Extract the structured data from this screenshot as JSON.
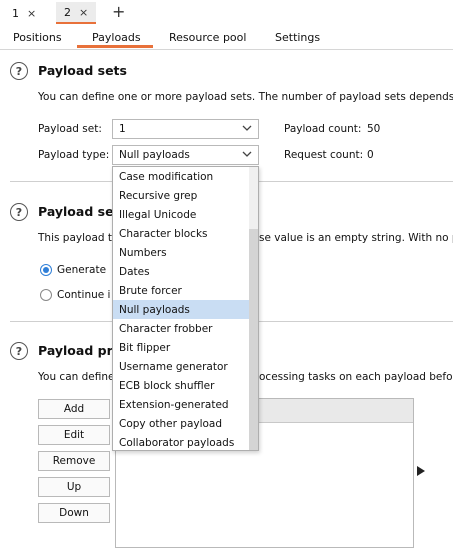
{
  "request_tabs": [
    {
      "label": "1",
      "close": "×"
    },
    {
      "label": "2",
      "close": "×"
    }
  ],
  "add_tab": "+",
  "subtabs": [
    "Positions",
    "Payloads",
    "Resource pool",
    "Settings"
  ],
  "payload_sets": {
    "title": "Payload sets",
    "description": "You can define one or more payload sets. The number of payload sets depends o",
    "set_label": "Payload set:",
    "set_value": "1",
    "type_label": "Payload type:",
    "type_value": "Null payloads",
    "count_label": "Payload count:",
    "count_value": "50",
    "request_label": "Request count:",
    "request_value": "0"
  },
  "payload_settings": {
    "title": "Payload set",
    "desc_left": "This payload ty",
    "desc_right": "se value is an empty string. With no pa",
    "radio1": "Generate",
    "radio2": "Continue i"
  },
  "payload_processing": {
    "title": "Payload pro",
    "desc_left": "You can define",
    "desc_right": "ocessing tasks on each payload before",
    "buttons": [
      "Add",
      "Edit",
      "Remove",
      "Up",
      "Down"
    ]
  },
  "dropdown_options": [
    "Case modification",
    "Recursive grep",
    "Illegal Unicode",
    "Character blocks",
    "Numbers",
    "Dates",
    "Brute forcer",
    "Null payloads",
    "Character frobber",
    "Bit flipper",
    "Username generator",
    "ECB block shuffler",
    "Extension-generated",
    "Copy other payload",
    "Collaborator payloads"
  ],
  "selected_option": "Null payloads",
  "colors": {
    "accent": "#e8713a",
    "selection": "#c9ddf3",
    "radio": "#2f7fd8"
  }
}
